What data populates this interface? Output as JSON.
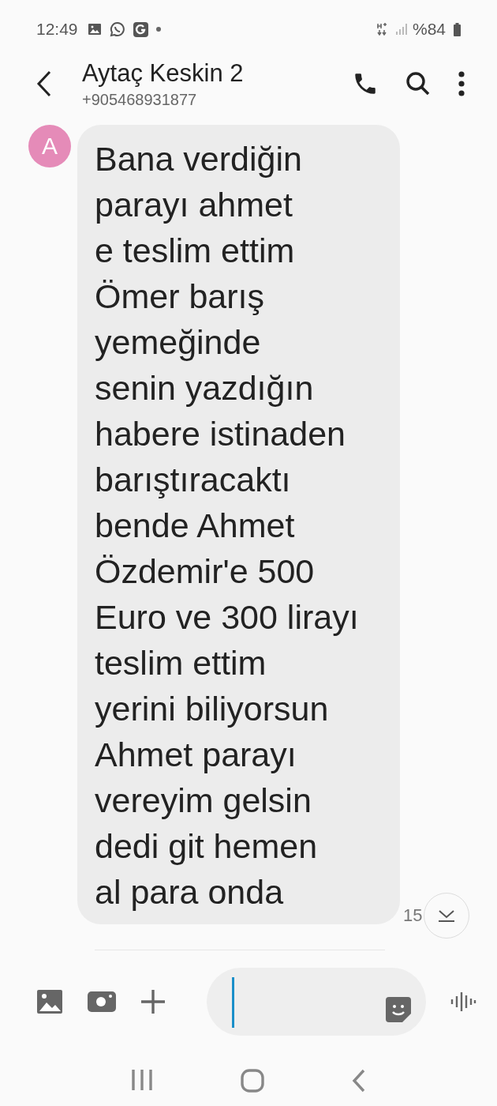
{
  "status_bar": {
    "time": "12:49",
    "battery": "%84"
  },
  "header": {
    "contact_name": "Aytaç Keskin 2",
    "phone_number": "+905468931877"
  },
  "message": {
    "avatar_letter": "A",
    "text": "Bana verdiğin\nparayı ahmet\ne teslim ettim\nÖmer barış\nyemeğinde\nsenin yazdığın\nhabere istinaden\nbarıştıracaktı\nbende Ahmet\nÖzdemir'e 500\nEuro ve 300 lirayı\nteslim ettim\nyerini biliyorsun\nAhmet parayı\nvereyim gelsin\ndedi git hemen\nal para onda",
    "time": "15"
  }
}
